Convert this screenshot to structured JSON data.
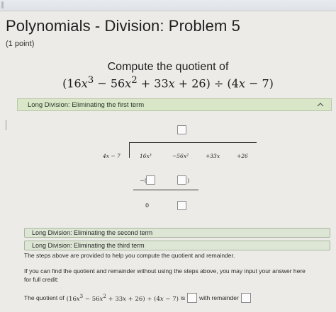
{
  "header": {
    "title": "Polynomials - Division: Problem 5",
    "points": "(1 point)"
  },
  "problem": {
    "prompt": "Compute the quotient of",
    "expression_html": "(16<i>x</i><sup>3</sup> − 56<i>x</i><sup>2</sup> + 33<i>x</i> + 26) ÷ (4<i>x</i> − 7)"
  },
  "steps": {
    "first_term_label": "Long Division: Eliminating the first term",
    "second_term_label": "Long Division: Eliminating the second term",
    "third_term_label": "Long Division: Eliminating the third term"
  },
  "division": {
    "divisor": "4x − 7",
    "dividend_terms": [
      "16x³",
      "−56x²",
      "+33x",
      "+26"
    ],
    "minus_sign": "−(",
    "close_paren": ")",
    "remainder_zero": "0"
  },
  "notes": {
    "steps_help": "The steps above are provided to help you compute the quotient and remainder.",
    "shortcut_line1": "If you can find the quotient and remainder without using the steps above, you may input your answer here",
    "shortcut_line2": "for full credit:"
  },
  "final": {
    "prefix": "The quotient of",
    "expression_html": "(16<i>x</i><sup>3</sup> − 56<i>x</i><sup>2</sup> + 33<i>x</i> + 26) ÷ (4<i>x</i> − 7)",
    "is_label": "is",
    "remainder_label": "with remainder"
  },
  "icons": {
    "collapse": "chevron-up-icon"
  },
  "colors": {
    "panel_bg": "#d9e6c7",
    "page_bg": "#ecebe7"
  }
}
